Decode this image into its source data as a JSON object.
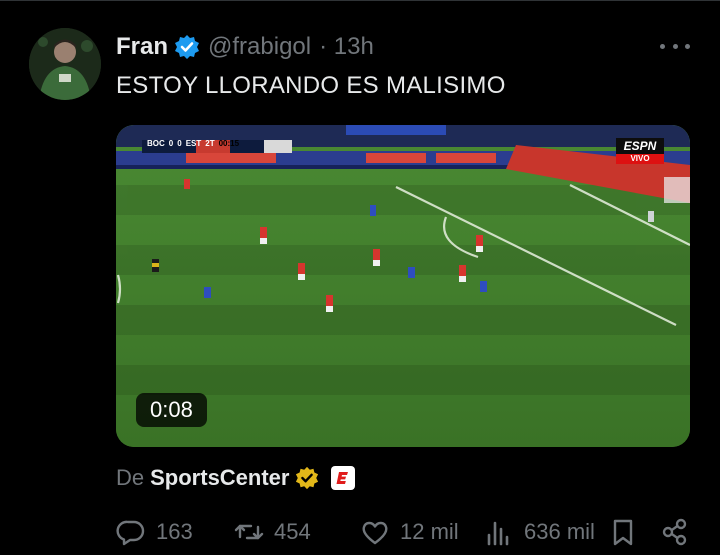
{
  "tweet": {
    "author": {
      "name": "Fran",
      "handle": "@frabigol",
      "time": "· 13h"
    },
    "text": "ESTOY LLORANDO ES MALISIMO"
  },
  "media": {
    "duration": "0:08",
    "scoreboard": {
      "home": "BOC",
      "home_score": "0",
      "away_score": "0",
      "away": "EST",
      "period": "2T",
      "clock": "00:15"
    },
    "broadcaster": {
      "logo": "ESPN",
      "live": "VIVO"
    }
  },
  "source": {
    "prefix": "De",
    "name": "SportsCenter"
  },
  "actions": {
    "replies": "163",
    "reposts": "454",
    "likes": "12 mil",
    "views": "636 mil"
  },
  "colors": {
    "background": "#000000",
    "text": "#e7e9ea",
    "muted": "#71767b",
    "verified_blue": "#1d9bf0",
    "verified_gold": "#e2b719",
    "pitch": "#3d7a2a"
  },
  "icons": [
    "verified-badge-icon",
    "more-icon",
    "gold-verified-badge-icon",
    "espn-icon",
    "reply-icon",
    "repost-icon",
    "like-icon",
    "views-icon",
    "bookmark-icon",
    "share-icon"
  ]
}
